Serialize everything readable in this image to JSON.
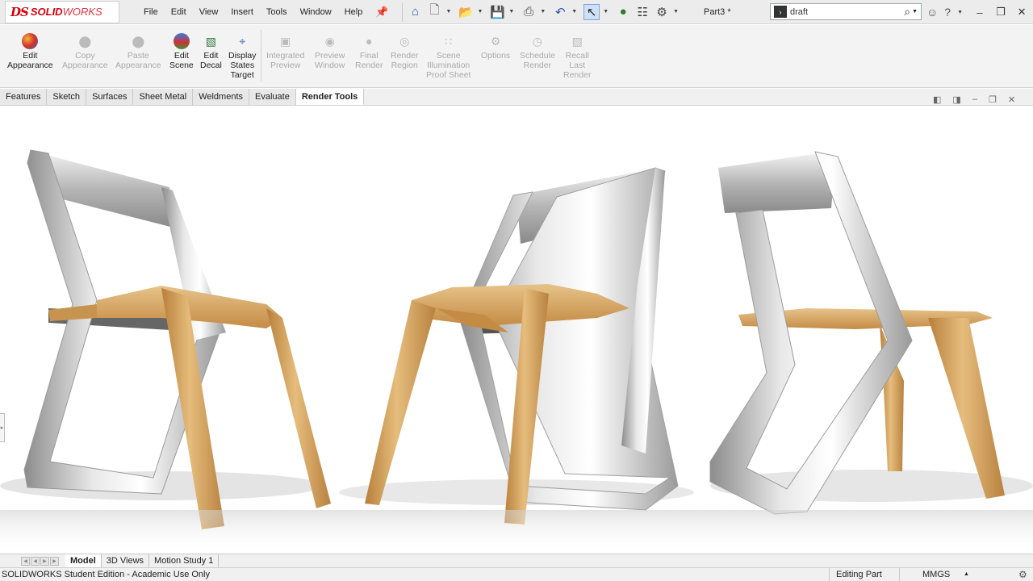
{
  "app": {
    "logo_ds": "DS",
    "logo_solid": "SOLID",
    "logo_works": "WORKS",
    "document_title": "Part3 *"
  },
  "menu": [
    "File",
    "Edit",
    "View",
    "Insert",
    "Tools",
    "Window",
    "Help"
  ],
  "search": {
    "value": "draft",
    "placeholder": ""
  },
  "ribbon": {
    "buttons": [
      {
        "label": "Edit\nAppearance",
        "enabled": true
      },
      {
        "label": "Copy\nAppearance",
        "enabled": false
      },
      {
        "label": "Paste\nAppearance",
        "enabled": false
      },
      {
        "label": "Edit\nScene",
        "enabled": true
      },
      {
        "label": "Edit\nDecal",
        "enabled": true
      },
      {
        "label": "Display\nStates\nTarget",
        "enabled": true
      },
      {
        "label": "Integrated\nPreview",
        "enabled": false
      },
      {
        "label": "Preview\nWindow",
        "enabled": false
      },
      {
        "label": "Final\nRender",
        "enabled": false
      },
      {
        "label": "Render\nRegion",
        "enabled": false
      },
      {
        "label": "Scene\nIllumination\nProof Sheet",
        "enabled": false
      },
      {
        "label": "Options",
        "enabled": false
      },
      {
        "label": "Schedule\nRender",
        "enabled": false
      },
      {
        "label": "Recall\nLast\nRender",
        "enabled": false
      }
    ]
  },
  "tabs": [
    "Features",
    "Sketch",
    "Surfaces",
    "Sheet Metal",
    "Weldments",
    "Evaluate",
    "Render Tools"
  ],
  "active_tab": "Render Tools",
  "bottom_tabs": [
    "Model",
    "3D Views",
    "Motion Study 1"
  ],
  "status": {
    "edition": "SOLIDWORKS Student Edition - Academic Use Only",
    "mode": "Editing Part",
    "units": "MMGS"
  },
  "colors": {
    "brand_red": "#d7000f",
    "wood": "#d6a35a",
    "steel": "#c9c9c9"
  }
}
